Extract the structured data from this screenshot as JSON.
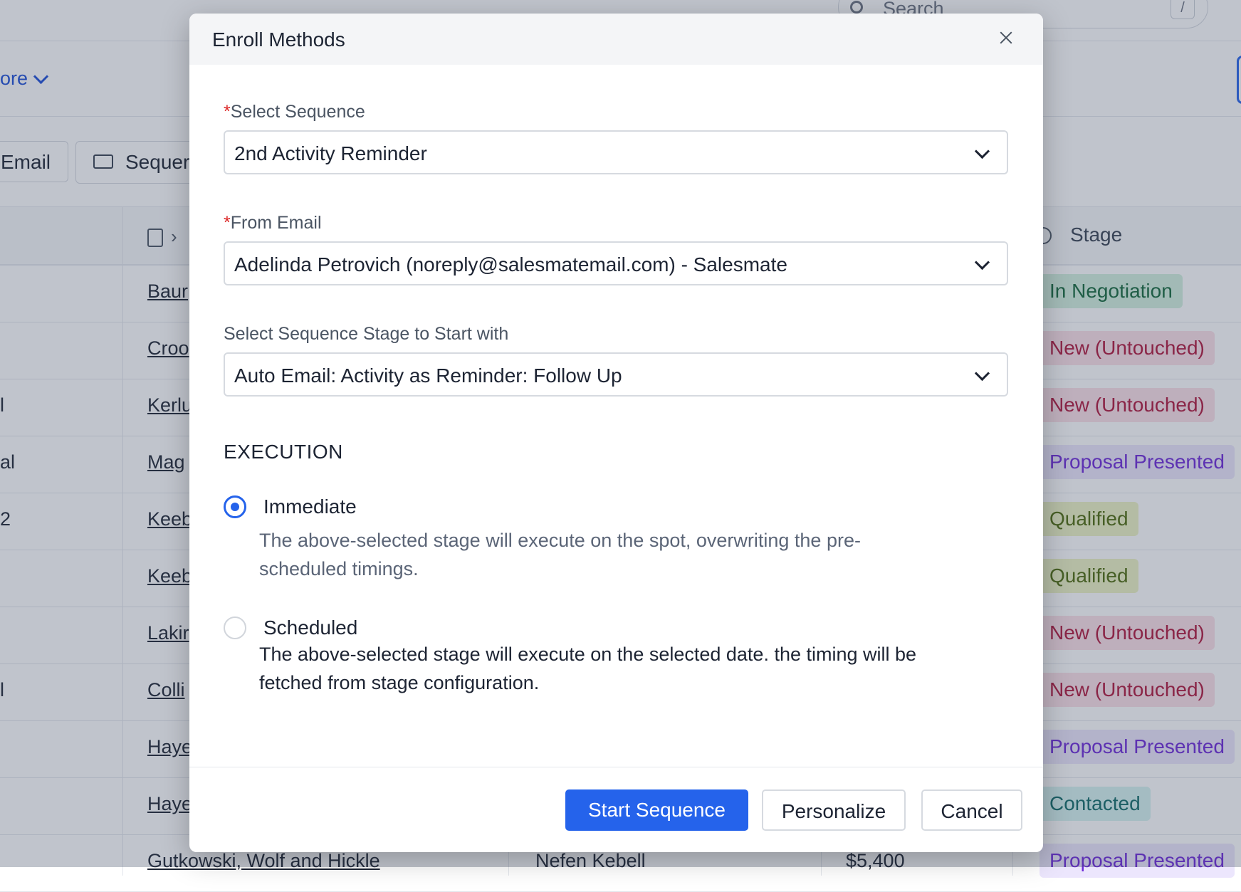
{
  "background": {
    "search_placeholder": "Search",
    "search_shortcut": "/",
    "more_label": "ore",
    "toolbar": {
      "email_label": "Email",
      "sequence_label": "Sequer"
    },
    "stage_header": "Stage",
    "rows": [
      {
        "left": "",
        "company": "Baur",
        "owner": "",
        "amount": "",
        "stage": "In Negotiation",
        "stage_class": "st-neg"
      },
      {
        "left": "",
        "company": "Croo",
        "owner": "",
        "amount": "",
        "stage": "New (Untouched)",
        "stage_class": "st-new"
      },
      {
        "left": "l",
        "company": "Kerlu",
        "owner": "",
        "amount": "",
        "stage": "New (Untouched)",
        "stage_class": "st-new"
      },
      {
        "left": "al",
        "company": "Mag",
        "owner": "",
        "amount": "",
        "stage": "Proposal Presented",
        "stage_class": "st-prop"
      },
      {
        "left": "2",
        "company": "Keeb",
        "owner": "",
        "amount": "",
        "stage": "Qualified",
        "stage_class": "st-qual"
      },
      {
        "left": "",
        "company": "Keeb",
        "owner": "",
        "amount": "",
        "stage": "Qualified",
        "stage_class": "st-qual"
      },
      {
        "left": "",
        "company": "Lakir",
        "owner": "",
        "amount": "",
        "stage": "New (Untouched)",
        "stage_class": "st-new"
      },
      {
        "left": "l",
        "company": "Colli",
        "owner": "",
        "amount": "",
        "stage": "New (Untouched)",
        "stage_class": "st-new"
      },
      {
        "left": "",
        "company": "Haye",
        "owner": "",
        "amount": "",
        "stage": "Proposal Presented",
        "stage_class": "st-prop"
      },
      {
        "left": "",
        "company": "Haye",
        "owner": "",
        "amount": "",
        "stage": "Contacted",
        "stage_class": "st-cont"
      },
      {
        "left": "",
        "company": "Gutkowski, Wolf and Hickle",
        "owner": "Nefen Kebell",
        "amount": "$5,400",
        "stage": "Proposal Presented",
        "stage_class": "st-prop"
      }
    ]
  },
  "modal": {
    "title": "Enroll Methods",
    "required_mark": "*",
    "fields": {
      "sequence": {
        "label": "Select Sequence",
        "value": "2nd Activity Reminder"
      },
      "from_email": {
        "label": "From Email",
        "value": "Adelinda Petrovich (noreply@salesmatemail.com) - Salesmate"
      },
      "stage": {
        "label": "Select Sequence Stage to Start with",
        "value": "Auto Email: Activity as Reminder: Follow Up"
      }
    },
    "execution": {
      "heading": "EXECUTION",
      "selected": "immediate",
      "immediate": {
        "label": "Immediate",
        "description": "The above-selected stage will execute on the spot, overwriting the pre-scheduled timings."
      },
      "scheduled": {
        "label": "Scheduled",
        "description": "The above-selected stage will execute on the selected date. the timing will be fetched from stage configuration."
      }
    },
    "buttons": {
      "start": "Start Sequence",
      "personalize": "Personalize",
      "cancel": "Cancel"
    }
  },
  "colors": {
    "primary": "#2563eb",
    "required": "#dc2626",
    "overlay": "rgba(59,70,96,0.32)"
  }
}
